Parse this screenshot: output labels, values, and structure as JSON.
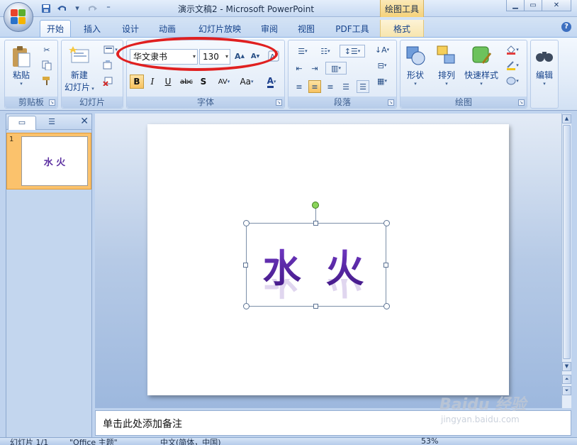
{
  "window": {
    "title": "演示文稿2 - Microsoft PowerPoint",
    "context_tool": "绘图工具"
  },
  "tabs": [
    {
      "label": "开始",
      "active": true
    },
    {
      "label": "插入"
    },
    {
      "label": "设计"
    },
    {
      "label": "动画"
    },
    {
      "label": "幻灯片放映"
    },
    {
      "label": "审阅"
    },
    {
      "label": "视图"
    },
    {
      "label": "PDF工具"
    },
    {
      "label": "格式",
      "contextual": true
    }
  ],
  "ribbon": {
    "clipboard": {
      "label": "剪贴板",
      "paste": "粘贴"
    },
    "slides": {
      "label": "幻灯片",
      "new_slide_line1": "新建",
      "new_slide_line2": "幻灯片"
    },
    "font": {
      "label": "字体",
      "font_name": "华文隶书",
      "font_size": "130",
      "bold": "B",
      "italic": "I",
      "underline": "U",
      "strike": "abc",
      "shadow": "S",
      "spacing": "AV",
      "case": "Aa",
      "color": "A"
    },
    "paragraph": {
      "label": "段落"
    },
    "drawing": {
      "label": "绘图",
      "shapes": "形状",
      "arrange": "排列",
      "quick_styles": "快速样式"
    },
    "editing": {
      "label": "编辑"
    }
  },
  "slide_pane": {
    "slide_number": "1",
    "thumb_text": "水 火"
  },
  "slide": {
    "wordart_text": "水 火"
  },
  "notes": {
    "placeholder": "单击此处添加备注"
  },
  "status": {
    "slide_info": "幻灯片 1/1",
    "theme": "\"Office 主题\"",
    "language": "中文(简体，中国)",
    "zoom": "53%"
  },
  "watermark": {
    "brand": "Baidu 经验",
    "url": "jingyan.baidu.com"
  },
  "colors": {
    "accent": "#15428b",
    "wordart": "#5b24a8",
    "highlight_oval": "#e02020"
  }
}
